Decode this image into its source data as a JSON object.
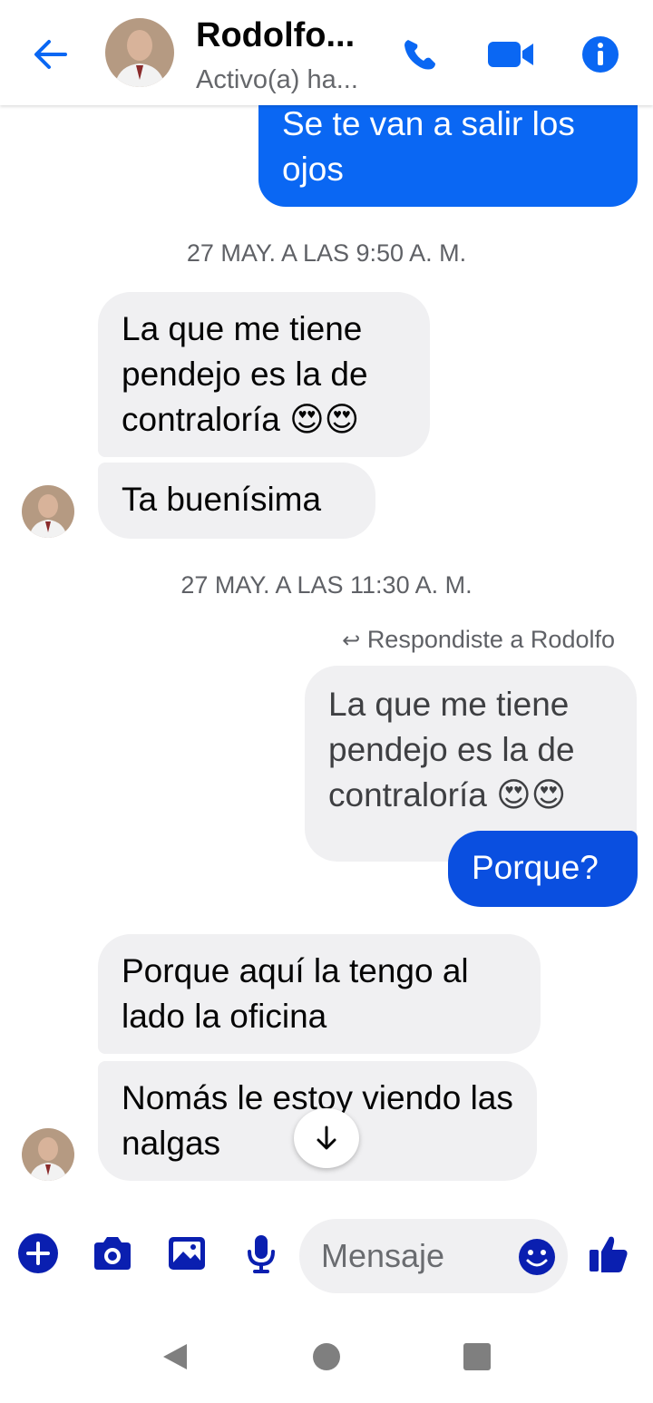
{
  "header": {
    "contact_name": "Rodolfo...",
    "status": "Activo(a) ha...",
    "accent_color": "#0a67f3"
  },
  "messages": [
    {
      "direction": "outgoing",
      "text": "Se te van a salir los ojos"
    },
    {
      "type": "timestamp",
      "text": "27 MAY. A LAS 9:50 A. M."
    },
    {
      "direction": "incoming",
      "text": "La que me tiene pendejo es la de contraloría 😍😍"
    },
    {
      "direction": "incoming",
      "text": "Ta buenísima"
    },
    {
      "type": "timestamp",
      "text": "27 MAY. A LAS 11:30 A. M."
    },
    {
      "type": "reply-hint",
      "text": "Respondiste a Rodolfo"
    },
    {
      "direction": "quoted",
      "text": "La que me tiene pendejo es la de contraloría 😍😍"
    },
    {
      "direction": "outgoing",
      "text": "Porque?"
    },
    {
      "direction": "incoming",
      "text": "Porque aquí la tengo al lado la oficina"
    },
    {
      "direction": "incoming",
      "text": "Nomás le estoy viendo las nalgas"
    }
  ],
  "composer": {
    "placeholder": "Mensaje"
  },
  "icons": [
    "back-arrow-icon",
    "phone-icon",
    "video-camera-icon",
    "info-icon",
    "plus-icon",
    "camera-icon",
    "image-icon",
    "microphone-icon",
    "emoji-icon",
    "thumbs-up-icon",
    "arrow-down-icon",
    "nav-back-icon",
    "nav-home-icon",
    "nav-recents-icon"
  ]
}
